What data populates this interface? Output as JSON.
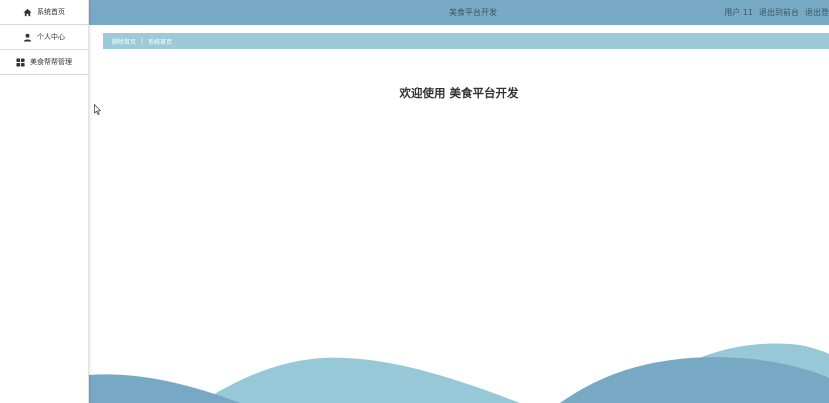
{
  "sidebar": {
    "items": [
      {
        "label": "系统首页",
        "icon": "home-icon"
      },
      {
        "label": "个人中心",
        "icon": "user-icon"
      },
      {
        "label": "美食帮帮管理",
        "icon": "grid-icon"
      }
    ]
  },
  "header": {
    "title": "美食平台开发",
    "user": "用户 11",
    "back_to_front": "退出到前台",
    "logout": "退出登"
  },
  "breadcrumb": {
    "home": "删除首页",
    "current": "系统首页"
  },
  "main": {
    "welcome": "欢迎使用 美食平台开发"
  },
  "colors": {
    "topbar": "#78aac6",
    "breadcrumb": "#9ccad8",
    "wave_light": "#97c8d7",
    "wave_dark": "#77a9c5"
  }
}
